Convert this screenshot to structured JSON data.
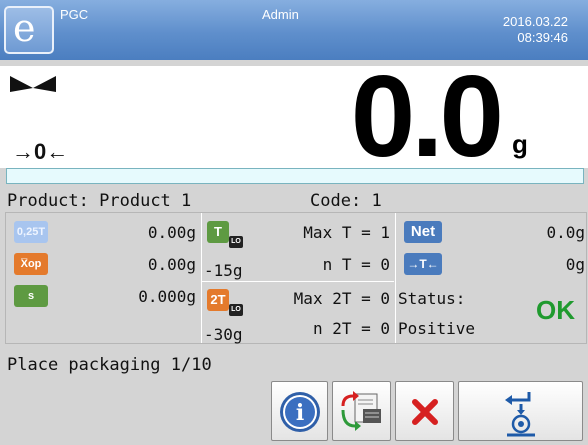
{
  "header": {
    "app_name": "PGC",
    "user": "Admin",
    "date": "2016.03.22",
    "time": "08:39:46",
    "logo_letter": "e"
  },
  "display": {
    "weight": "0.0",
    "unit": "g",
    "zero_indicator": "→0←",
    "stability_icon": "bowtie-icon"
  },
  "product": {
    "product_label": "Product:",
    "product_value": "Product 1",
    "code_label": "Code:",
    "code_value": "1"
  },
  "stats": {
    "items": [
      {
        "badge": "0,25T",
        "value": "0.00g"
      },
      {
        "badge": "X̅op",
        "value": "0.00g"
      },
      {
        "badge": "s",
        "value": "0.000g"
      }
    ]
  },
  "tare": {
    "t_badge": "T",
    "t_lo": "LO",
    "t_value": "-15g",
    "max_t": "Max T = 1",
    "n_t": "n T = 0",
    "t2_badge": "2T",
    "t2_lo": "LO",
    "t2_value": "-30g",
    "max_2t": "Max 2T = 0",
    "n_2t": "n 2T = 0"
  },
  "result": {
    "net_badge": "Net",
    "net_value": "0.0g",
    "tare_badge": "→T←",
    "tare_value": "0g",
    "status_label": "Status:",
    "status_value": "Positive",
    "ok_label": "OK"
  },
  "message": "Place packaging 1/10",
  "buttons": [
    {
      "name": "info-button",
      "icon": "info-icon"
    },
    {
      "name": "change-product-button",
      "icon": "product-swap-icon"
    },
    {
      "name": "cancel-button",
      "icon": "close-x-icon"
    },
    {
      "name": "enter-tare-button",
      "icon": "enter-packaging-icon"
    }
  ],
  "colors": {
    "topbar": "#5f8fcc",
    "ok_green": "#1f9a2e",
    "badge_orange": "#e47a2c",
    "badge_green": "#5e9a42",
    "badge_blue": "#4a7bbd",
    "cancel_red": "#d62020"
  }
}
